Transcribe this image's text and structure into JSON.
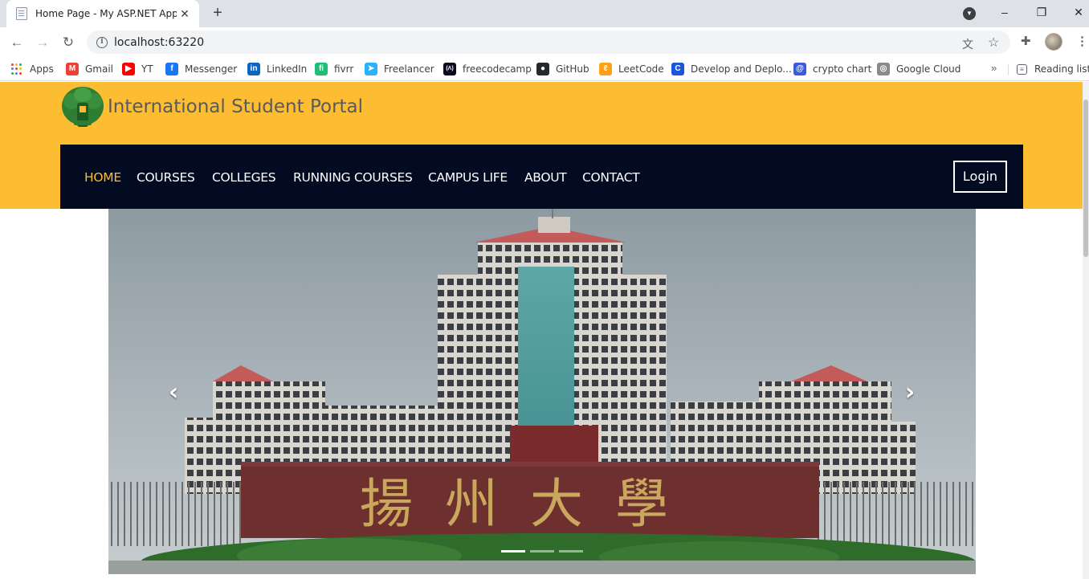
{
  "browser": {
    "tab_title": "Home Page - My ASP.NET Application",
    "tab_close": "✕",
    "new_tab": "+",
    "url": "localhost:63220",
    "window_controls": {
      "minimize": "–",
      "restore": "❐",
      "close": "✕"
    },
    "bookmarks": [
      {
        "label": "Apps",
        "icon": "apps-grid-icon"
      },
      {
        "label": "Gmail",
        "icon": "gmail-icon",
        "glyph": "M",
        "color": "#ea4335"
      },
      {
        "label": "YT",
        "icon": "youtube-icon",
        "glyph": "▶",
        "color": "#ff0000"
      },
      {
        "label": "Messenger",
        "icon": "facebook-icon",
        "glyph": "f",
        "color": "#1877f2"
      },
      {
        "label": "LinkedIn",
        "icon": "linkedin-icon",
        "glyph": "in",
        "color": "#0a66c2"
      },
      {
        "label": "fivrr",
        "icon": "fiverr-icon",
        "glyph": "fi",
        "color": "#1dbf73"
      },
      {
        "label": "Freelancer",
        "icon": "freelancer-icon",
        "glyph": "➤",
        "color": "#29b2fe"
      },
      {
        "label": "freecodecamp",
        "icon": "freecodecamp-icon",
        "glyph": "(Λ)",
        "color": "#0a0a23"
      },
      {
        "label": "GitHub",
        "icon": "github-icon",
        "glyph": "●",
        "color": "#24292e"
      },
      {
        "label": "LeetCode",
        "icon": "leetcode-icon",
        "glyph": "ℓ",
        "color": "#ffa116"
      },
      {
        "label": "Develop and Deplo...",
        "icon": "develop-icon",
        "glyph": "C",
        "color": "#1a56db"
      },
      {
        "label": "crypto chart",
        "icon": "crypto-icon",
        "glyph": "@",
        "color": "#3b5bdb"
      },
      {
        "label": "Google Cloud",
        "icon": "google-cloud-icon",
        "glyph": "◎",
        "color": "#8a8a8a"
      }
    ],
    "more": "»",
    "reading_list": "Reading list"
  },
  "site": {
    "title": "International Student Portal",
    "nav": [
      {
        "label": "HOME",
        "active": true
      },
      {
        "label": "COURSES"
      },
      {
        "label": "COLLEGES"
      },
      {
        "label": "RUNNING COURSES"
      },
      {
        "label": "CAMPUS LIFE"
      },
      {
        "label": "ABOUT"
      },
      {
        "label": "CONTACT"
      }
    ],
    "login": "Login",
    "carousel": {
      "prev": "‹",
      "next": "›",
      "slide_count": 3,
      "active_slide": 1,
      "sign_text": "揚州大學"
    }
  },
  "colors": {
    "header_yellow": "#fcbd33",
    "navbar": "#020b21",
    "active_link": "#fcbd33"
  }
}
